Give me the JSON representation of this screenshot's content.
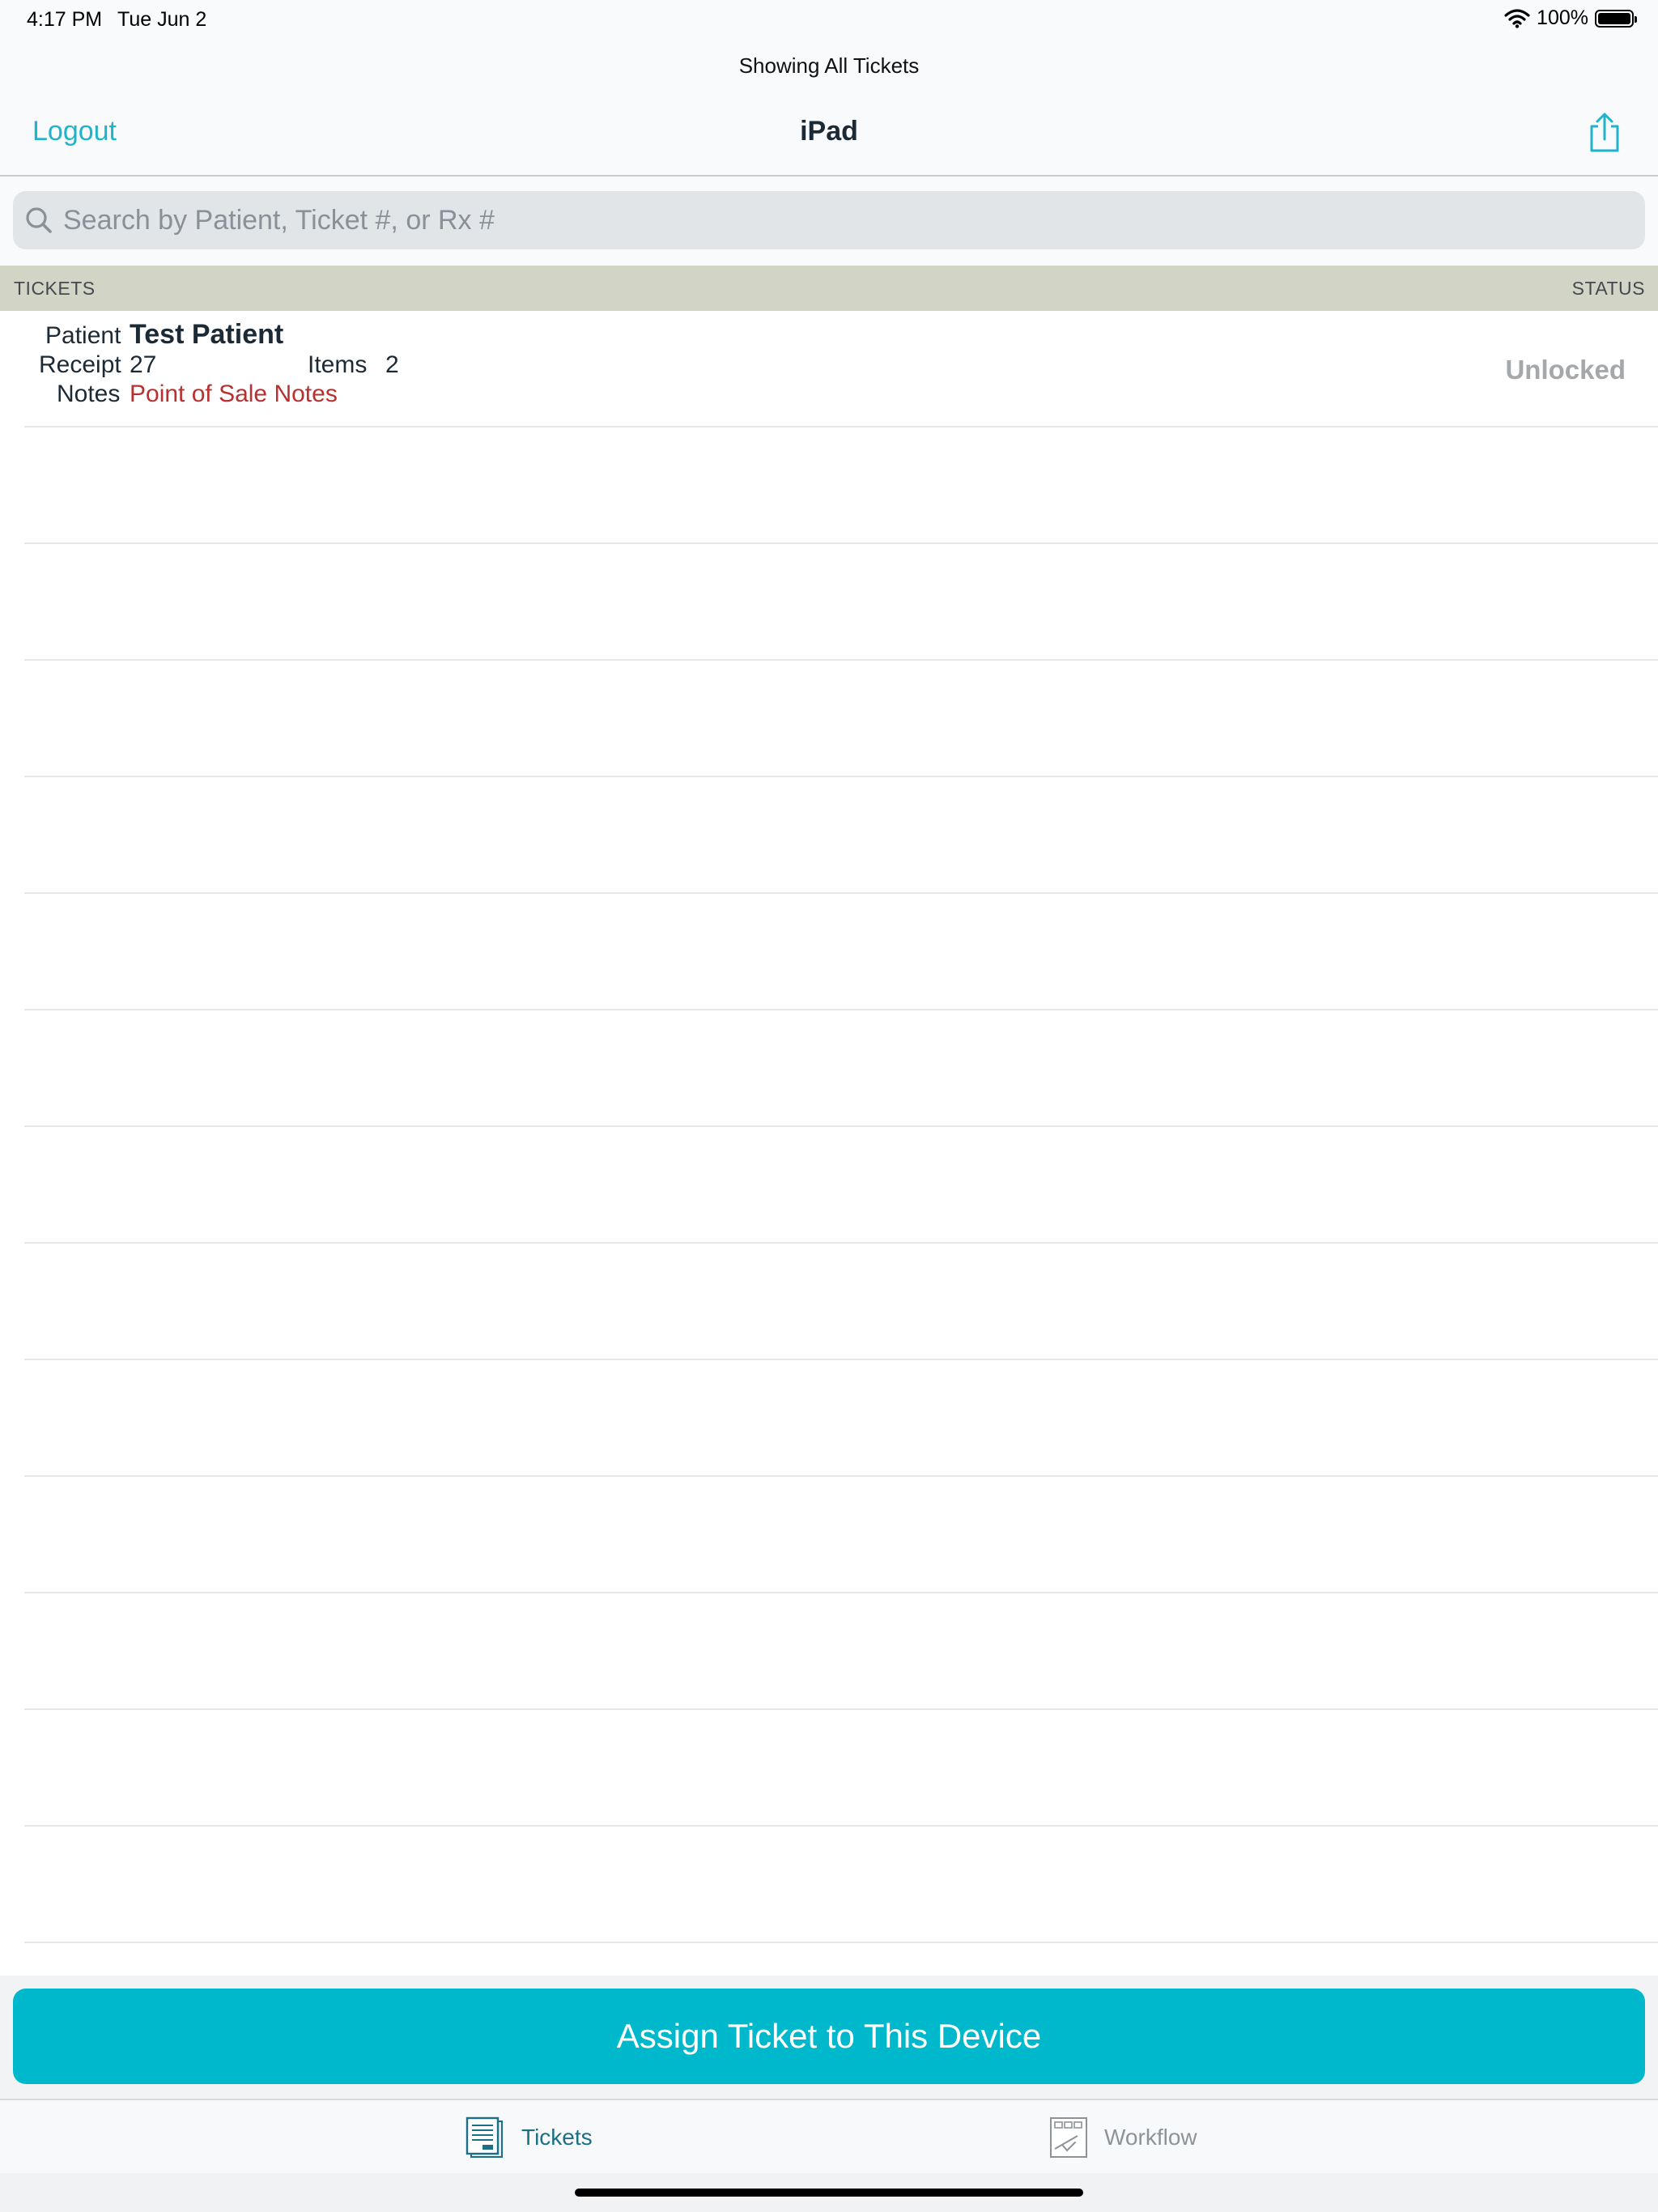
{
  "status_bar": {
    "time": "4:17 PM",
    "date": "Tue Jun 2",
    "battery_percent": "100%",
    "battery_level": 1.0
  },
  "nav": {
    "prompt": "Showing All Tickets",
    "title": "iPad",
    "logout_label": "Logout",
    "share_icon": "share-icon"
  },
  "search": {
    "placeholder": "Search by Patient, Ticket #, or Rx #",
    "value": ""
  },
  "table_header": {
    "left": "TICKETS",
    "right": "STATUS"
  },
  "tickets": [
    {
      "patient_label": "Patient",
      "patient_name": "Test Patient",
      "receipt_label": "Receipt",
      "receipt_value": "27",
      "items_label": "Items",
      "items_value": "2",
      "notes_label": "Notes",
      "notes_value": "Point of Sale Notes",
      "status": "Unlocked"
    }
  ],
  "assign_button": "Assign Ticket to This Device",
  "tabs": [
    {
      "label": "Tickets",
      "icon": "tickets-icon",
      "selected": true
    },
    {
      "label": "Workflow",
      "icon": "workflow-icon",
      "selected": false
    }
  ],
  "colors": {
    "accent": "#00b8cc",
    "link": "#1fb4c9",
    "notes_red": "#b8302f",
    "header_band": "#d2d4c6",
    "status_gray": "#a5a8ab",
    "tab_selected": "#1b6f86"
  }
}
